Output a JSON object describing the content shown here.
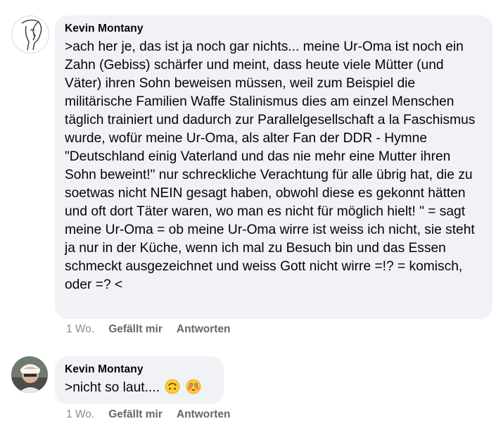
{
  "comments": [
    {
      "author": "Kevin Montany",
      "text": ">ach her je, das ist ja noch gar nichts... meine Ur-Oma ist noch ein Zahn (Gebiss) schärfer und meint, dass heute viele Mütter (und Väter) ihren Sohn beweisen müssen, weil zum Beispiel die militärische Familien Waffe Stalinismus dies am einzel Menschen  täglich trainiert und dadurch zur Parallelgesellschaft a la Faschismus wurde, wofür meine Ur-Oma, als alter Fan der DDR - Hymne \"Deutschland einig Vaterland und das nie mehr eine Mutter ihren Sohn beweint!\" nur schreckliche Verachtung für alle übrig hat, die zu soetwas nicht NEIN gesagt haben, obwohl diese es gekonnt hätten und oft dort Täter waren, wo man es nicht für möglich hielt! \" = sagt meine Ur-Oma = ob meine Ur-Oma wirre ist weiss ich nicht, sie steht ja nur in der Küche, wenn ich mal zu Besuch bin und das Essen schmeckt ausgezeichnet und weiss Gott nicht wirre =!? = komisch, oder =? <",
      "time": "1 Wo.",
      "like_label": "Gefällt mir",
      "reply_label": "Antworten"
    },
    {
      "author": "Kevin Montany",
      "text": ">nicht so laut....",
      "emojis": [
        "upside-down-face-emoji",
        "flushed-face-emoji"
      ],
      "time": "1 Wo.",
      "like_label": "Gefällt mir",
      "reply_label": "Antworten"
    }
  ]
}
